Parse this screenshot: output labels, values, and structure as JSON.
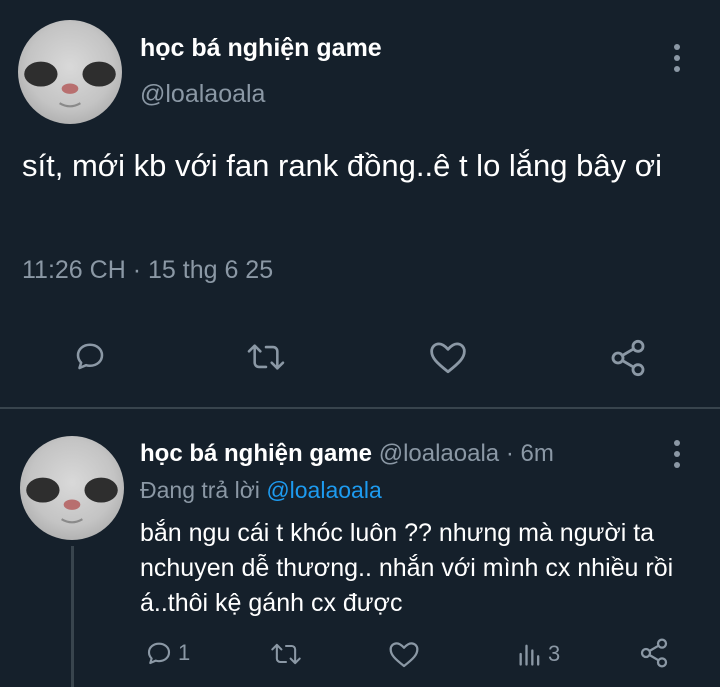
{
  "main_tweet": {
    "author_name": "học bá nghiện game",
    "handle": "@loalaoala",
    "text": "sít, mới kb với fan rank đồng..ê t lo lắng bây ơi",
    "time": "11:26 CH",
    "separator": "·",
    "date": "15 thg 6 25",
    "actions": [
      "reply-icon",
      "retweet-icon",
      "like-icon",
      "share-icon"
    ]
  },
  "reply_tweet": {
    "author_name": "học bá nghiện game",
    "handle": "@loalaoala",
    "separator": "·",
    "time_ago": "6m",
    "replying_label": "Đang trả lời",
    "replying_handle": "@loalaoala",
    "text": "bắn ngu cái t khóc luôn ?? nhưng mà người ta nchuyen dễ thương.. nhắn với mình cx nhiều rồi á..thôi kệ gánh cx được",
    "reply_count": "1",
    "views_count": "3"
  },
  "colors": {
    "background": "#15202b",
    "text_primary": "#ffffff",
    "text_secondary": "#8b98a5",
    "link": "#1d9bf0",
    "divider": "#38444d"
  }
}
